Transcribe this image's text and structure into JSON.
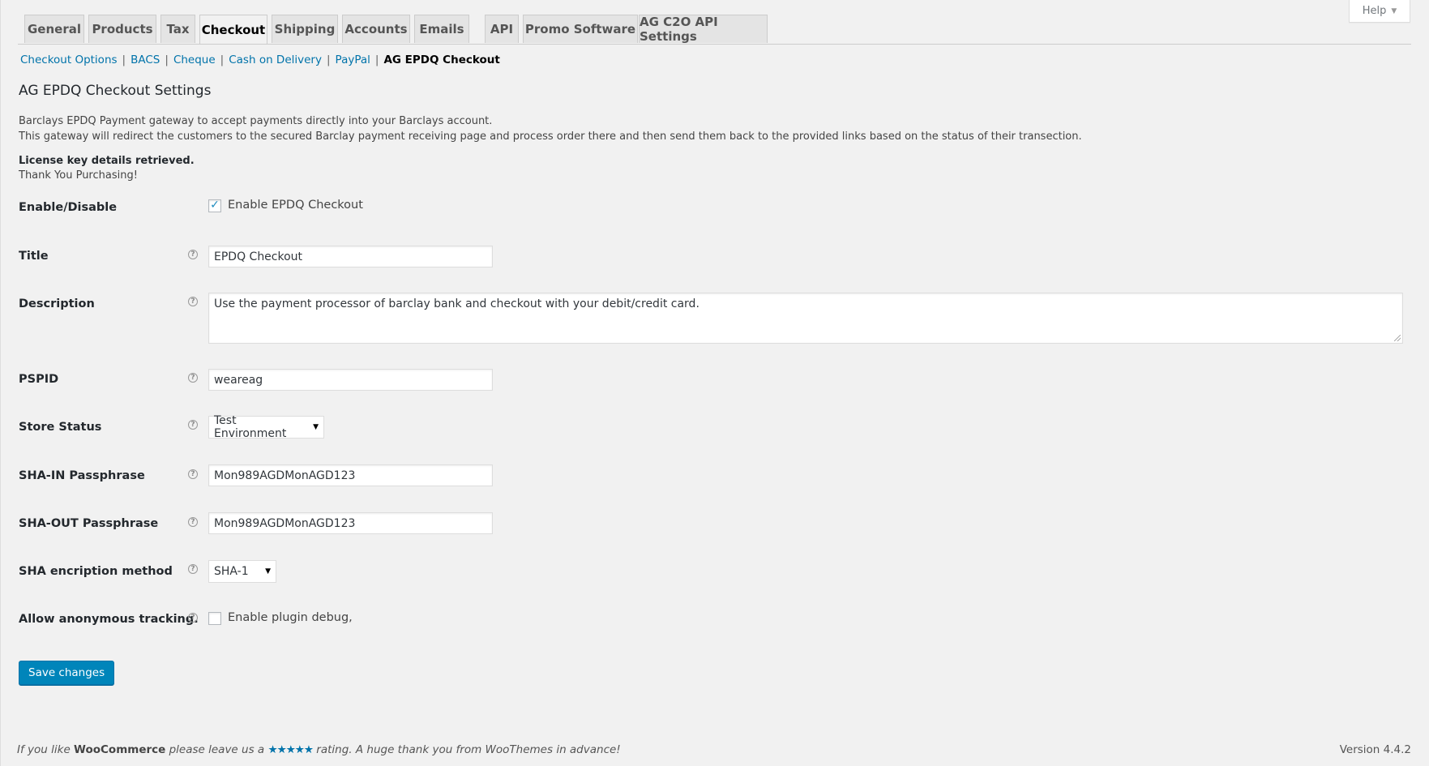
{
  "help": {
    "label": "Help"
  },
  "tabs": [
    {
      "label": "General"
    },
    {
      "label": "Products"
    },
    {
      "label": "Tax"
    },
    {
      "label": "Checkout"
    },
    {
      "label": "Shipping"
    },
    {
      "label": "Accounts"
    },
    {
      "label": "Emails"
    },
    {
      "label": "API"
    },
    {
      "label": "Promo Software"
    },
    {
      "label": "AG C2O API Settings"
    }
  ],
  "active_tab": "Checkout",
  "subnav": {
    "links": [
      "Checkout Options",
      "BACS",
      "Cheque",
      "Cash on Delivery",
      "PayPal"
    ],
    "separator": "|",
    "current": "AG EPDQ Checkout"
  },
  "page": {
    "title": "AG EPDQ Checkout Settings",
    "description_line1": "Barclays EPDQ Payment gateway to accept payments directly into your Barclays account.",
    "description_line2": "This gateway will redirect the customers to the secured Barclay payment receiving page and process order there and then send them back to the provided links based on the status of their transection.",
    "license_status": "License key details retrieved.",
    "license_thanks": "Thank You Purchasing!"
  },
  "fields": {
    "enable": {
      "label": "Enable/Disable",
      "checkbox_label": "Enable EPDQ Checkout",
      "checked": true
    },
    "title": {
      "label": "Title",
      "value": "EPDQ Checkout"
    },
    "description": {
      "label": "Description",
      "value": "Use the payment processor of barclay bank and checkout with your debit/credit card."
    },
    "pspid": {
      "label": "PSPID",
      "value": "weareag"
    },
    "store_status": {
      "label": "Store Status",
      "value": "Test Environment"
    },
    "sha_in": {
      "label": "SHA-IN Passphrase",
      "value": "Mon989AGDMonAGD123"
    },
    "sha_out": {
      "label": "SHA-OUT Passphrase",
      "value": "Mon989AGDMonAGD123"
    },
    "sha_method": {
      "label": "SHA encription method",
      "value": "SHA-1"
    },
    "tracking": {
      "label": "Allow anonymous tracking.",
      "checkbox_label": "Enable plugin debug,",
      "checked": false
    }
  },
  "save_label": "Save changes",
  "footer": {
    "text_prefix": "If you like ",
    "brand": "WooCommerce",
    "text_mid": " please leave us a ",
    "stars": "★★★★★",
    "text_suffix": " rating. A huge thank you from WooThemes in advance!",
    "version": "Version 4.4.2"
  },
  "colors": {
    "accent": "#0073aa",
    "button": "#0085ba",
    "background": "#f1f1f1"
  },
  "icons": {
    "help_tip": "question-circle-icon",
    "checkmark": "checkmark-icon",
    "dropdown": "caret-down-icon"
  }
}
